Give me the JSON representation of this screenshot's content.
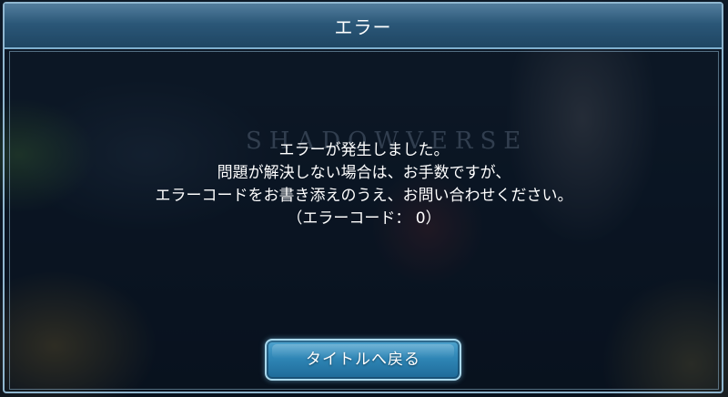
{
  "dialog": {
    "title": "エラー",
    "watermark": "SHADOWVERSE",
    "message_lines": [
      "エラーが発生しました。",
      "問題が解決しない場合は、お手数ですが、",
      "エラーコードをお書き添えのうえ、お問い合わせください。",
      "（エラーコード： 0）"
    ],
    "button_label": "タイトルへ戻る"
  },
  "colors": {
    "header": "#2b5778",
    "frame": "#8fb6cf",
    "button": "#2f86b6",
    "text": "#ffffff"
  }
}
